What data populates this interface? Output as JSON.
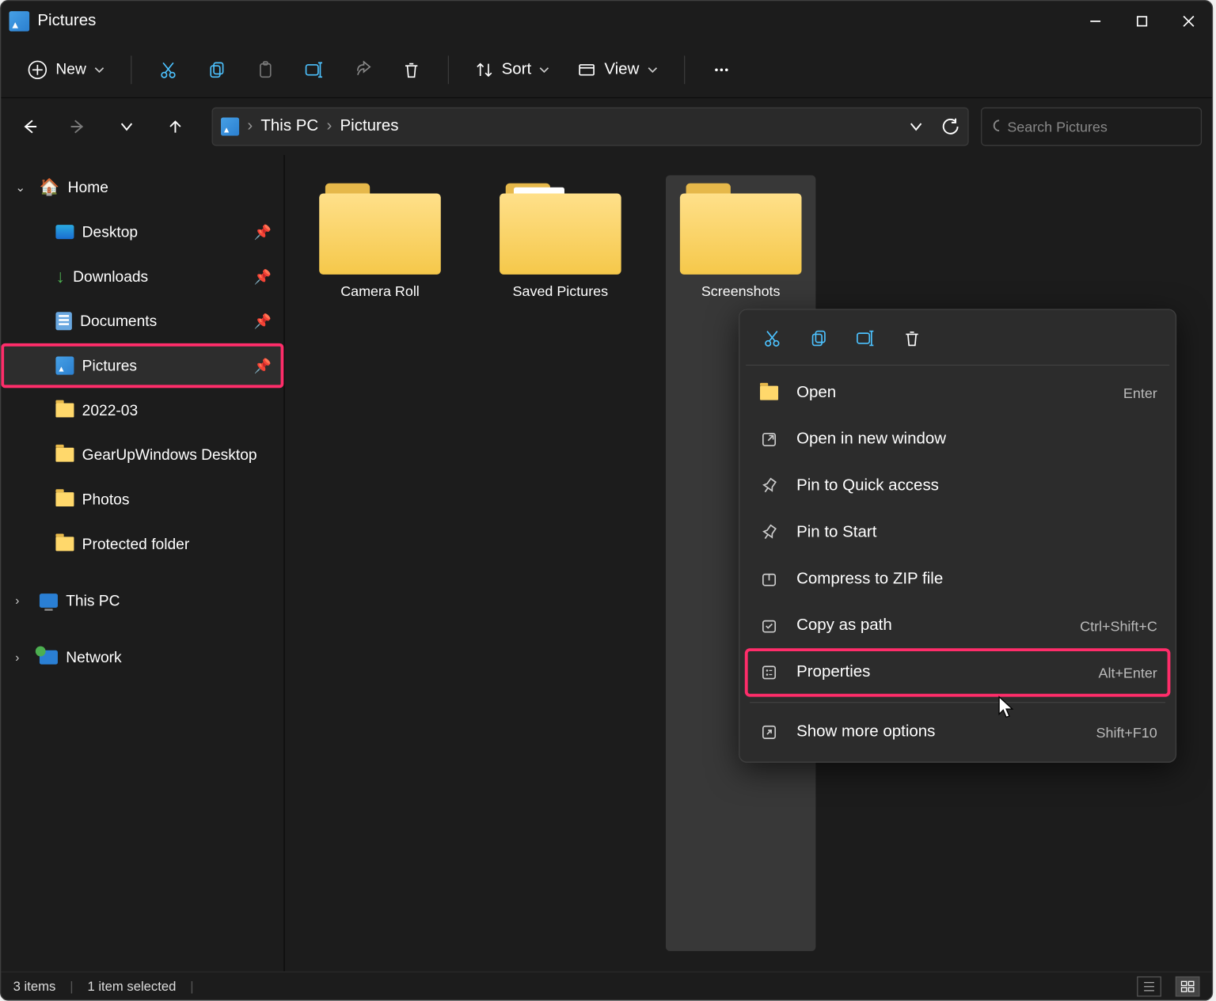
{
  "titlebar": {
    "title": "Pictures"
  },
  "toolbar": {
    "new_label": "New",
    "sort_label": "Sort",
    "view_label": "View"
  },
  "breadcrumb": {
    "root": "This PC",
    "current": "Pictures"
  },
  "search": {
    "placeholder": "Search Pictures"
  },
  "sidebar": {
    "home": "Home",
    "desktop": "Desktop",
    "downloads": "Downloads",
    "documents": "Documents",
    "pictures": "Pictures",
    "sub1": "2022-03",
    "sub2": "GearUpWindows Desktop",
    "sub3": "Photos",
    "sub4": "Protected folder",
    "this_pc": "This PC",
    "network": "Network"
  },
  "content": {
    "items": [
      {
        "label": "Camera Roll"
      },
      {
        "label": "Saved Pictures"
      },
      {
        "label": "Screenshots"
      }
    ]
  },
  "context_menu": {
    "open": "Open",
    "open_sc": "Enter",
    "open_new": "Open in new window",
    "pin_qa": "Pin to Quick access",
    "pin_start": "Pin to Start",
    "zip": "Compress to ZIP file",
    "copy_path": "Copy as path",
    "copy_path_sc": "Ctrl+Shift+C",
    "properties": "Properties",
    "properties_sc": "Alt+Enter",
    "more": "Show more options",
    "more_sc": "Shift+F10"
  },
  "statusbar": {
    "count": "3 items",
    "selected": "1 item selected"
  }
}
